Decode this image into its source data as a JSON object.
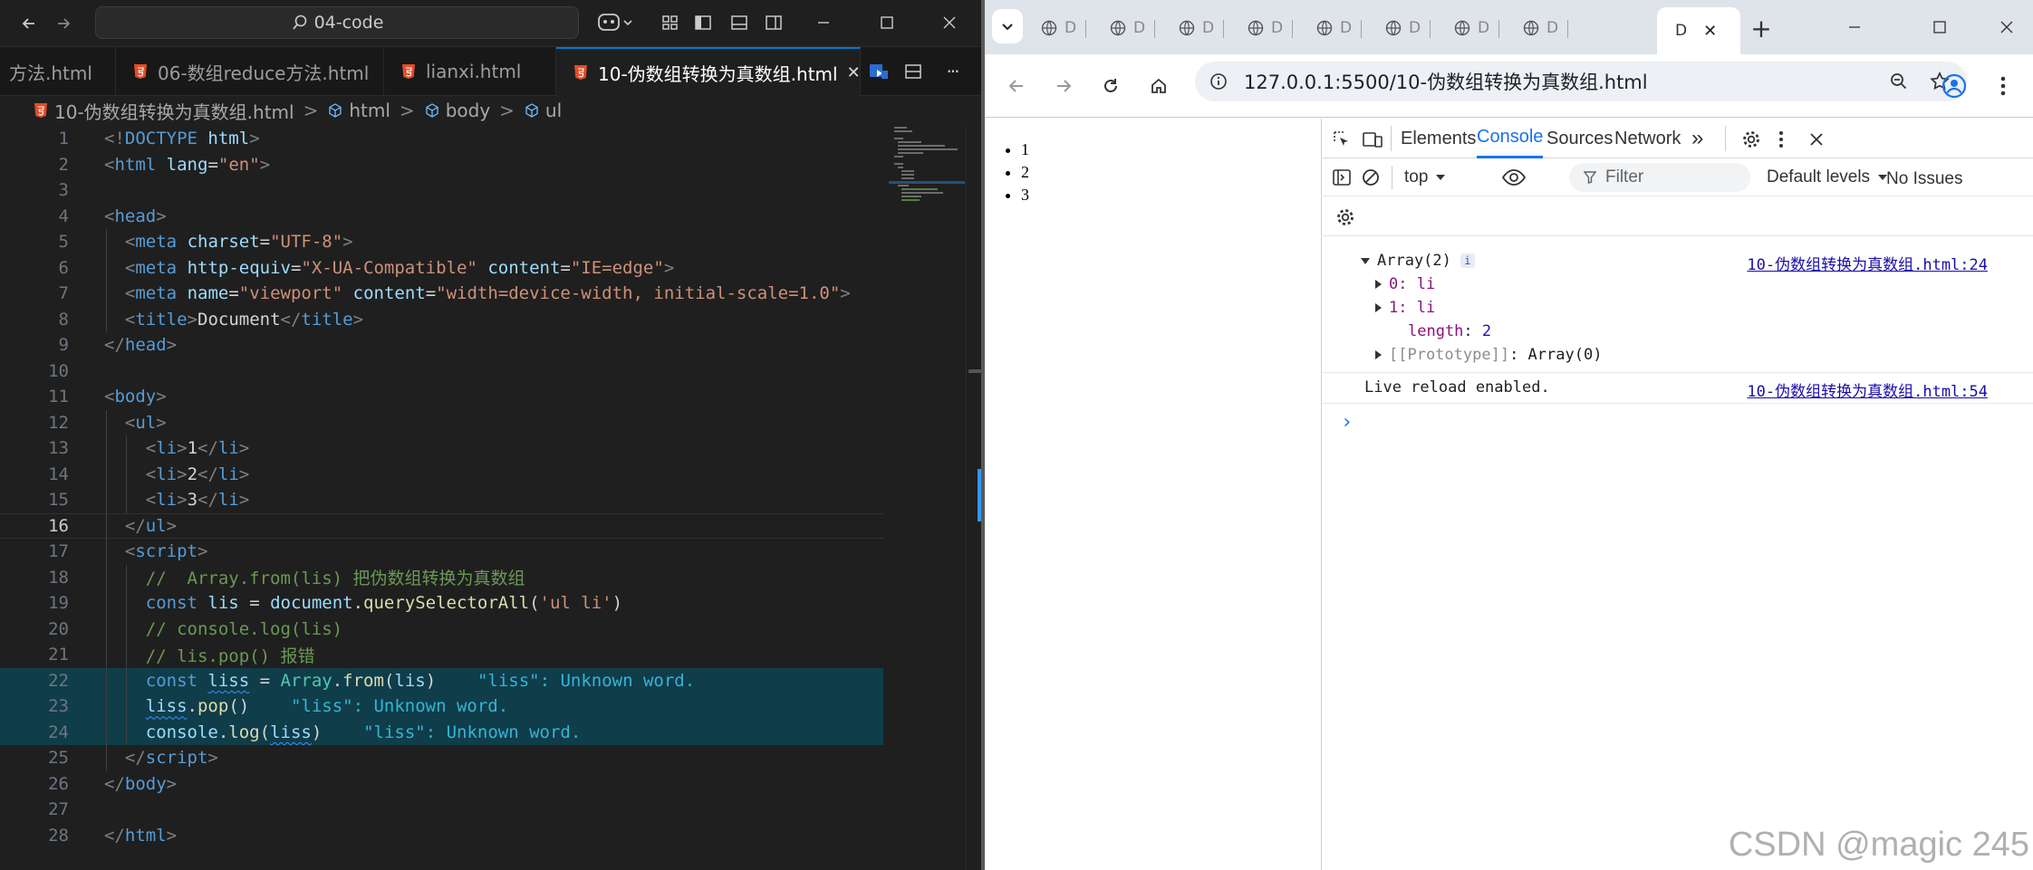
{
  "vscode": {
    "search_text": "04-code",
    "tabs": [
      {
        "label": "方法.html"
      },
      {
        "label": "06-数组reduce方法.html"
      },
      {
        "label": "lianxi.html"
      },
      {
        "label": "10-伪数组转换为真数组.html"
      }
    ],
    "close_glyph": "✕",
    "more_glyph": "···",
    "breadcrumb": {
      "file": "10-伪数组转换为真数组.html",
      "sep": ">",
      "items": [
        "html",
        "body",
        "ul"
      ]
    },
    "current_line": "16",
    "lines": [
      {
        "n": "1",
        "t": [
          [
            "br",
            "<!"
          ],
          [
            "tag",
            "DOCTYPE"
          ],
          [
            "tx",
            " "
          ],
          [
            "at",
            "html"
          ],
          [
            "br",
            ">"
          ]
        ]
      },
      {
        "n": "2",
        "t": [
          [
            "br",
            "<"
          ],
          [
            "tag",
            "html"
          ],
          [
            "tx",
            " "
          ],
          [
            "at",
            "lang"
          ],
          [
            "tx",
            "="
          ],
          [
            "st",
            "\"en\""
          ],
          [
            "br",
            ">"
          ]
        ]
      },
      {
        "n": "3",
        "t": []
      },
      {
        "n": "4",
        "t": [
          [
            "br",
            "<"
          ],
          [
            "tag",
            "head"
          ],
          [
            "br",
            ">"
          ]
        ]
      },
      {
        "n": "5",
        "t": [
          [
            "tx",
            "  "
          ],
          [
            "br",
            "<"
          ],
          [
            "tag",
            "meta"
          ],
          [
            "tx",
            " "
          ],
          [
            "at",
            "charset"
          ],
          [
            "tx",
            "="
          ],
          [
            "st",
            "\"UTF-8\""
          ],
          [
            "br",
            ">"
          ]
        ]
      },
      {
        "n": "6",
        "t": [
          [
            "tx",
            "  "
          ],
          [
            "br",
            "<"
          ],
          [
            "tag",
            "meta"
          ],
          [
            "tx",
            " "
          ],
          [
            "at",
            "http-equiv"
          ],
          [
            "tx",
            "="
          ],
          [
            "st",
            "\"X-UA-Compatible\""
          ],
          [
            "tx",
            " "
          ],
          [
            "at",
            "content"
          ],
          [
            "tx",
            "="
          ],
          [
            "st",
            "\"IE=edge\""
          ],
          [
            "br",
            ">"
          ]
        ]
      },
      {
        "n": "7",
        "t": [
          [
            "tx",
            "  "
          ],
          [
            "br",
            "<"
          ],
          [
            "tag",
            "meta"
          ],
          [
            "tx",
            " "
          ],
          [
            "at",
            "name"
          ],
          [
            "tx",
            "="
          ],
          [
            "st",
            "\"viewport\""
          ],
          [
            "tx",
            " "
          ],
          [
            "at",
            "content"
          ],
          [
            "tx",
            "="
          ],
          [
            "st",
            "\"width=device-width, initial-scale=1.0\""
          ],
          [
            "br",
            ">"
          ]
        ]
      },
      {
        "n": "8",
        "t": [
          [
            "tx",
            "  "
          ],
          [
            "br",
            "<"
          ],
          [
            "tag",
            "title"
          ],
          [
            "br",
            ">"
          ],
          [
            "tx",
            "Document"
          ],
          [
            "br",
            "</"
          ],
          [
            "tag",
            "title"
          ],
          [
            "br",
            ">"
          ]
        ]
      },
      {
        "n": "9",
        "t": [
          [
            "br",
            "</"
          ],
          [
            "tag",
            "head"
          ],
          [
            "br",
            ">"
          ]
        ]
      },
      {
        "n": "10",
        "t": []
      },
      {
        "n": "11",
        "t": [
          [
            "br",
            "<"
          ],
          [
            "tag",
            "body"
          ],
          [
            "br",
            ">"
          ]
        ]
      },
      {
        "n": "12",
        "t": [
          [
            "tx",
            "  "
          ],
          [
            "br",
            "<"
          ],
          [
            "tag",
            "ul"
          ],
          [
            "br",
            ">"
          ]
        ]
      },
      {
        "n": "13",
        "t": [
          [
            "tx",
            "    "
          ],
          [
            "br",
            "<"
          ],
          [
            "tag",
            "li"
          ],
          [
            "br",
            ">"
          ],
          [
            "tx",
            "1"
          ],
          [
            "br",
            "</"
          ],
          [
            "tag",
            "li"
          ],
          [
            "br",
            ">"
          ]
        ]
      },
      {
        "n": "14",
        "t": [
          [
            "tx",
            "    "
          ],
          [
            "br",
            "<"
          ],
          [
            "tag",
            "li"
          ],
          [
            "br",
            ">"
          ],
          [
            "tx",
            "2"
          ],
          [
            "br",
            "</"
          ],
          [
            "tag",
            "li"
          ],
          [
            "br",
            ">"
          ]
        ]
      },
      {
        "n": "15",
        "t": [
          [
            "tx",
            "    "
          ],
          [
            "br",
            "<"
          ],
          [
            "tag",
            "li"
          ],
          [
            "br",
            ">"
          ],
          [
            "tx",
            "3"
          ],
          [
            "br",
            "</"
          ],
          [
            "tag",
            "li"
          ],
          [
            "br",
            ">"
          ]
        ]
      },
      {
        "n": "16",
        "t": [
          [
            "tx",
            "  "
          ],
          [
            "br",
            "</"
          ],
          [
            "tag",
            "ul"
          ],
          [
            "br",
            ">"
          ]
        ]
      },
      {
        "n": "17",
        "t": [
          [
            "tx",
            "  "
          ],
          [
            "br",
            "<"
          ],
          [
            "tag",
            "script"
          ],
          [
            "br",
            ">"
          ]
        ]
      },
      {
        "n": "18",
        "t": [
          [
            "tx",
            "    "
          ],
          [
            "cm",
            "//  Array.from(lis) 把伪数组转换为真数组"
          ]
        ]
      },
      {
        "n": "19",
        "t": [
          [
            "tx",
            "    "
          ],
          [
            "kw",
            "const"
          ],
          [
            "tx",
            " "
          ],
          [
            "vr",
            "lis"
          ],
          [
            "tx",
            " = "
          ],
          [
            "vr",
            "document"
          ],
          [
            "tx",
            "."
          ],
          [
            "fn",
            "querySelectorAll"
          ],
          [
            "pn",
            "("
          ],
          [
            "st",
            "'ul li'"
          ],
          [
            "pn",
            ")"
          ]
        ]
      },
      {
        "n": "20",
        "t": [
          [
            "tx",
            "    "
          ],
          [
            "cm",
            "// console.log(lis)"
          ]
        ]
      },
      {
        "n": "21",
        "t": [
          [
            "tx",
            "    "
          ],
          [
            "cm",
            "// lis.pop() 报错"
          ]
        ]
      },
      {
        "n": "22",
        "t": [
          [
            "tx",
            "    "
          ],
          [
            "kw",
            "const"
          ],
          [
            "tx",
            " "
          ],
          [
            "vrs",
            "liss"
          ],
          [
            "tx",
            " = "
          ],
          [
            "cl",
            "Array"
          ],
          [
            "tx",
            "."
          ],
          [
            "fn",
            "from"
          ],
          [
            "pn",
            "("
          ],
          [
            "vr",
            "lis"
          ],
          [
            "pn",
            ")"
          ],
          [
            "tx",
            "    "
          ],
          [
            "er",
            "\"liss\": Unknown word."
          ]
        ]
      },
      {
        "n": "23",
        "t": [
          [
            "tx",
            "    "
          ],
          [
            "vrs",
            "liss"
          ],
          [
            "tx",
            "."
          ],
          [
            "fn",
            "pop"
          ],
          [
            "pn",
            "()"
          ],
          [
            "tx",
            "    "
          ],
          [
            "er",
            "\"liss\": Unknown word."
          ]
        ]
      },
      {
        "n": "24",
        "t": [
          [
            "tx",
            "    "
          ],
          [
            "vr",
            "console"
          ],
          [
            "tx",
            "."
          ],
          [
            "fn",
            "log"
          ],
          [
            "pn",
            "("
          ],
          [
            "vrs",
            "liss"
          ],
          [
            "pn",
            ")"
          ],
          [
            "tx",
            "    "
          ],
          [
            "er",
            "\"liss\": Unknown word."
          ]
        ]
      },
      {
        "n": "25",
        "t": [
          [
            "tx",
            "  "
          ],
          [
            "br",
            "</"
          ],
          [
            "tag",
            "script"
          ],
          [
            "br",
            ">"
          ]
        ]
      },
      {
        "n": "26",
        "t": [
          [
            "br",
            "</"
          ],
          [
            "tag",
            "body"
          ],
          [
            "br",
            ">"
          ]
        ]
      },
      {
        "n": "27",
        "t": []
      },
      {
        "n": "28",
        "t": [
          [
            "br",
            "</"
          ],
          [
            "tag",
            "html"
          ],
          [
            "br",
            ">"
          ]
        ]
      }
    ]
  },
  "chrome": {
    "bg_tab_label": "D",
    "active_tab_label": "D",
    "tab_close": "✕",
    "new_tab": "+",
    "url": "127.0.0.1:5500/10-伪数组转换为真数组.html",
    "page_list": [
      "1",
      "2",
      "3"
    ],
    "devtools": {
      "tabs": [
        "Elements",
        "Console",
        "Sources",
        "Network"
      ],
      "more_tabs": "»",
      "context": "top",
      "filter_placeholder": "Filter",
      "levels": "Default levels",
      "issues": "No Issues",
      "log": {
        "summary": "Array(2)",
        "info_badge": "i",
        "source1": "10-伪数组转换为真数组.html:24",
        "items": [
          {
            "key": "0",
            "value": "li"
          },
          {
            "key": "1",
            "value": "li"
          }
        ],
        "length_key": "length",
        "length_value": "2",
        "proto_key": "[[Prototype]]",
        "proto_value": "Array(0)",
        "live_reload": "Live reload enabled.",
        "source2": "10-伪数组转换为真数组.html:54",
        "prompt": "›"
      }
    }
  },
  "watermark": "CSDN @magic 245"
}
